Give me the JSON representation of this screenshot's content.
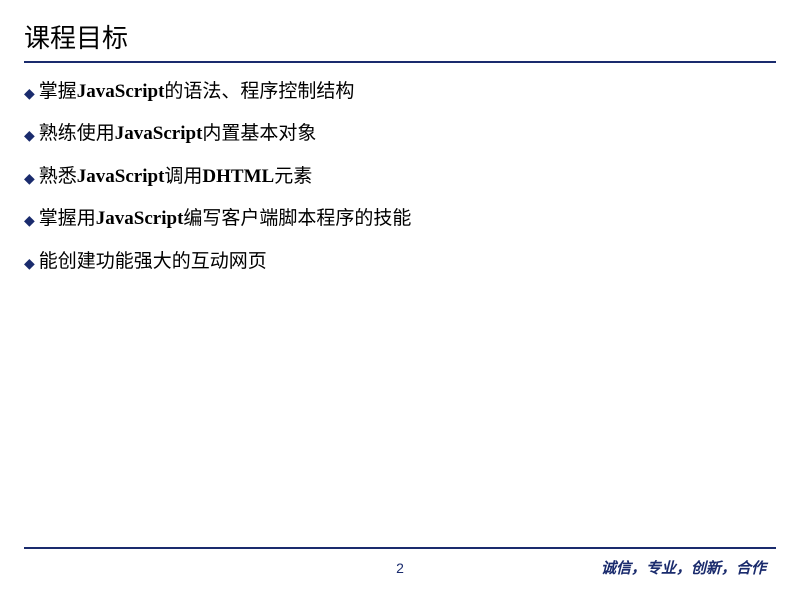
{
  "slide": {
    "title": "课程目标",
    "bullets": [
      {
        "parts": [
          {
            "text": "掌握",
            "style": "normal"
          },
          {
            "text": "JavaScript",
            "style": "bold"
          },
          {
            "text": "的语法、程序控制结构",
            "style": "normal"
          }
        ]
      },
      {
        "parts": [
          {
            "text": "熟练使用",
            "style": "normal"
          },
          {
            "text": "JavaScript",
            "style": "bold"
          },
          {
            "text": "内置基本对象",
            "style": "normal"
          }
        ]
      },
      {
        "parts": [
          {
            "text": "熟悉",
            "style": "normal"
          },
          {
            "text": "JavaScript",
            "style": "bold"
          },
          {
            "text": "调用",
            "style": "normal"
          },
          {
            "text": "DHTML",
            "style": "bold"
          },
          {
            "text": "元素",
            "style": "normal"
          }
        ]
      },
      {
        "parts": [
          {
            "text": "掌握用",
            "style": "normal"
          },
          {
            "text": "JavaScript",
            "style": "bold"
          },
          {
            "text": "编写客户端脚本程序的技能",
            "style": "normal"
          }
        ]
      },
      {
        "parts": [
          {
            "text": "能创建功能强大的互动网页",
            "style": "normal"
          }
        ]
      }
    ],
    "pageNumber": "2",
    "motto": "诚信，专业，创新，合作",
    "bulletMarker": "◆"
  }
}
